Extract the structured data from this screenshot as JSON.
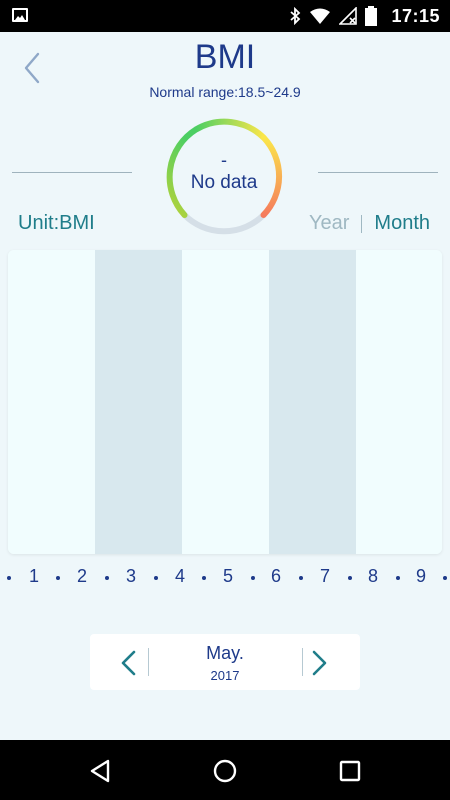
{
  "status_bar": {
    "time": "17:15",
    "icons": [
      "image-icon",
      "bluetooth-icon",
      "wifi-icon",
      "no-signal-icon",
      "battery-icon"
    ]
  },
  "header": {
    "title": "BMI",
    "subtitle": "Normal range:18.5~24.9"
  },
  "gauge": {
    "value": "-",
    "label": "No data",
    "colors": [
      "#b7d23a",
      "#4ccf63",
      "#fbe64a",
      "#f57b5c",
      "#d5dfe7"
    ]
  },
  "controls": {
    "unit_label": "Unit:BMI",
    "year_label": "Year",
    "month_label": "Month",
    "selected": "Month"
  },
  "chart": {
    "columns": 5,
    "x_ticks": [
      "1",
      "2",
      "3",
      "4",
      "5",
      "6",
      "7",
      "8",
      "9"
    ]
  },
  "period_nav": {
    "month": "May.",
    "year": "2017"
  },
  "colors": {
    "accent": "#1f7d8a",
    "primary_text": "#1e3a8a",
    "background": "#eef7fa",
    "chart_dark": "#d8e8ee"
  }
}
